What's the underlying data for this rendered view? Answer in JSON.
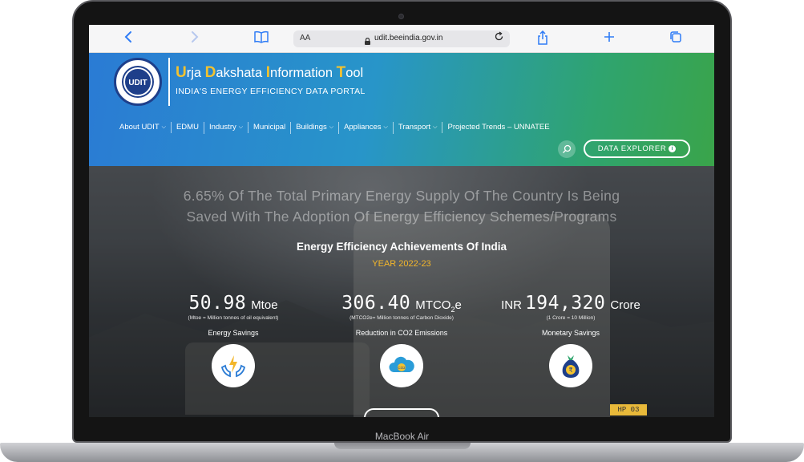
{
  "device": {
    "label": "MacBook Air"
  },
  "browser": {
    "text_size_label": "AA",
    "url": "udit.beeindia.gov.in"
  },
  "site": {
    "logo_text": "UDIT",
    "title_parts": [
      {
        "cap": "U",
        "rest": "rja "
      },
      {
        "cap": "D",
        "rest": "akshata "
      },
      {
        "cap": "I",
        "rest": "nformation "
      },
      {
        "cap": "T",
        "rest": "ool"
      }
    ],
    "subtitle": "INDIA'S ENERGY EFFICIENCY DATA PORTAL"
  },
  "nav": {
    "items": [
      {
        "label": "About UDIT",
        "dropdown": true
      },
      {
        "label": "EDMU",
        "dropdown": false
      },
      {
        "label": "Industry",
        "dropdown": true
      },
      {
        "label": "Municipal",
        "dropdown": false
      },
      {
        "label": "Buildings",
        "dropdown": true
      },
      {
        "label": "Appliances",
        "dropdown": true
      },
      {
        "label": "Transport",
        "dropdown": true
      },
      {
        "label": "Projected Trends – UNNATEE",
        "dropdown": false
      }
    ],
    "explorer_label": "DATA EXPLORER",
    "search_icon": "search-icon"
  },
  "hero": {
    "tagline_line1": "6.65% Of The Total Primary Energy Supply Of The Country Is Being",
    "tagline_line2": "Saved With The Adoption Of Energy Efficiency Schemes/Programs",
    "title": "Energy Efficiency Achievements Of India",
    "year": "YEAR 2022-23",
    "plate_text": "HP 03",
    "stats": [
      {
        "prefix": "",
        "value": "50.98",
        "unit": "Mtoe",
        "note": "(Mtoe = Million tonnes of oil equivalent)",
        "label": "Energy Savings",
        "icon": "energy-hands-icon"
      },
      {
        "prefix": "",
        "value": "306.40",
        "unit": "MTCO",
        "unit_sub": "2",
        "unit_tail": "e",
        "note": "(MTCO2e= Million tonnes of Carbon Dioxide)",
        "label": "Reduction in CO2 Emissions",
        "icon": "co2-cloud-icon"
      },
      {
        "prefix": "INR",
        "value": "194,320",
        "unit": "Crore",
        "note": "(1 Crore = 10 Million)",
        "label": "Monetary Savings",
        "icon": "money-bag-icon"
      }
    ]
  },
  "colors": {
    "accent_yellow": "#f3c22f",
    "year_orange": "#f3b62a",
    "header_blue": "#2a7bd4",
    "header_green": "#3aa44a",
    "safari_blue": "#2f7cf6"
  }
}
